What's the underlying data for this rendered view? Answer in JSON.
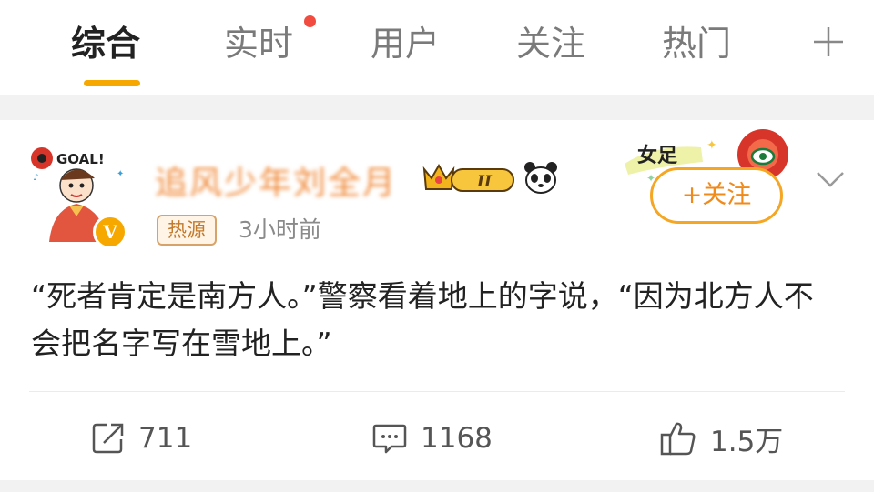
{
  "tabs": {
    "items": [
      {
        "label": "综合"
      },
      {
        "label": "实时"
      },
      {
        "label": "用户"
      },
      {
        "label": "关注"
      },
      {
        "label": "热门"
      }
    ],
    "active": "综合",
    "add_icon": "plus-icon"
  },
  "post": {
    "username": "追风少年刘全月",
    "source_tag": "热源",
    "time": "3小时前",
    "badge_level": "II",
    "deco_badge_text": "女足",
    "avatar_text": "GOAL!",
    "vip_mark": "V",
    "follow_label": "+关注",
    "text": "“死者肯定是南方人。”警察看着地上的字说，“因为北方人不会把名字写在雪地上。”",
    "actions": {
      "repost_count": "711",
      "comment_count": "1168",
      "like_count": "1.5万"
    }
  },
  "colors": {
    "accent": "#f7a800",
    "follow": "#f08a1a",
    "notification_dot": "#f24b3f",
    "username": "#f08a3a"
  }
}
